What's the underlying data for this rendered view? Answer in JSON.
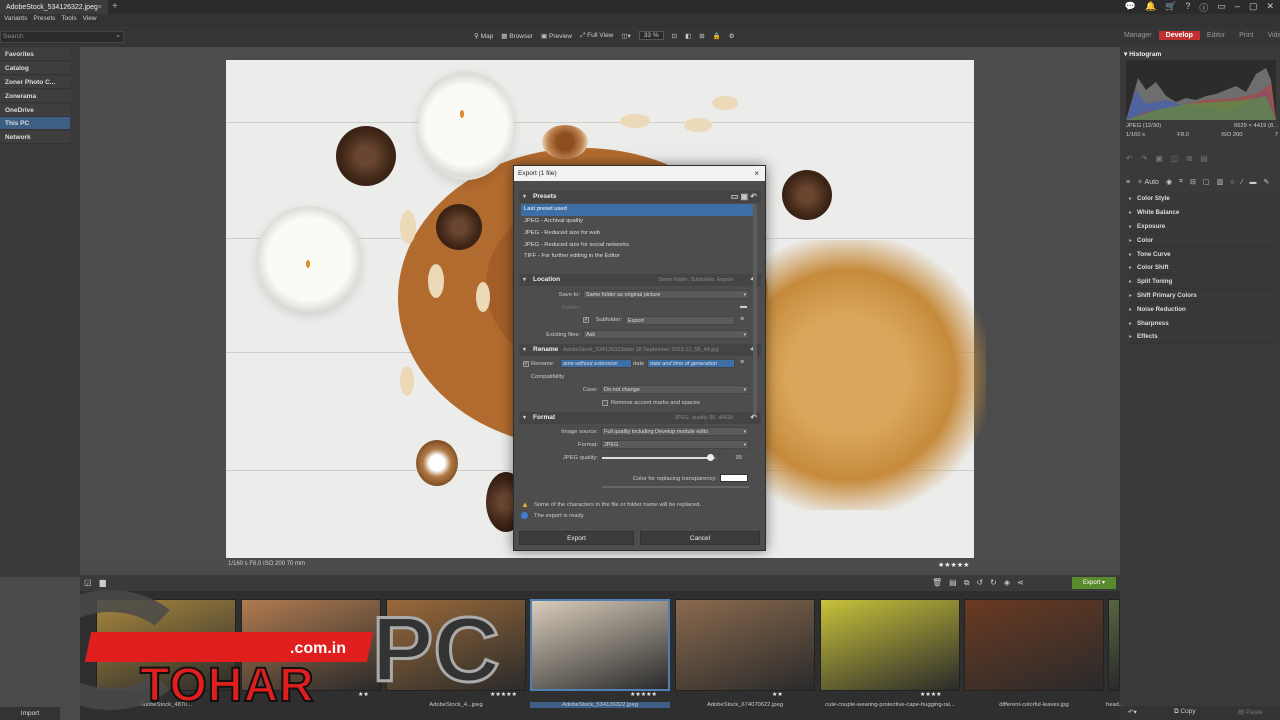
{
  "window": {
    "tab_title": "AdobeStock_534126322.jpeg",
    "tab_close": "×",
    "new_tab": "+"
  },
  "menu": [
    "Variants",
    "Presets",
    "Tools",
    "View"
  ],
  "top_icons": [
    "💬",
    "🔔",
    "🛒",
    "?",
    "ⓘ",
    "▭",
    "–",
    "▢",
    "✕"
  ],
  "search": {
    "placeholder": "Search"
  },
  "view_tools": {
    "map": "Map",
    "browser": "Browser",
    "preview": "Preview",
    "full_view": "Full View",
    "zoom": "33 %"
  },
  "modules": {
    "manager": "Manager",
    "develop": "Develop",
    "editor": "Editor",
    "print": "Print",
    "video": "Video"
  },
  "left_nav": [
    {
      "label": "Favorites"
    },
    {
      "label": "Catalog"
    },
    {
      "label": "Zoner Photo C..."
    },
    {
      "label": "Zonerama"
    },
    {
      "label": "OneDrive"
    },
    {
      "label": "This PC"
    },
    {
      "label": "Network"
    }
  ],
  "photo_status": "1/160 s   F8.0   ISO 200   70 mm",
  "photo_stars": "★★★★★",
  "dialog": {
    "title": "Export (1 file)",
    "close": "×",
    "presets": {
      "heading": "Presets",
      "items": [
        "Last preset used",
        "JPEG - Archival quality",
        "JPEG - Reduced size for web",
        "JPEG - Reduced size for social networks",
        "TIFF - For further editing in the Editor"
      ]
    },
    "location": {
      "heading": "Location",
      "summary": "Same folder, Subfolder: Export",
      "save_to_label": "Save to:",
      "save_to_value": "Same folder as original picture",
      "folder_label": "Folder:",
      "subfolder_label": "Subfolder:",
      "subfolder_value": "Export",
      "existing_label": "Existing files:",
      "existing_value": "Ask"
    },
    "rename": {
      "heading": "Rename",
      "summary": "AdobeStock_534126322date 18 September 2023 12_58_44.jpg",
      "rename_label": "Rename:",
      "token1": "ame without extension",
      "token_sep": "date",
      "token2": "date and time of generation",
      "compat_label": "Compatibility",
      "case_label": "Case:",
      "case_value": "Do not change",
      "remove_accents": "Remove accent marks and spaces"
    },
    "format": {
      "heading": "Format",
      "summary": "JPEG, quality 95, sRGB",
      "source_label": "Image source:",
      "source_value": "Full quality including Develop module edits",
      "format_label": "Format:",
      "format_value": "JPEG",
      "quality_label": "JPEG quality:",
      "quality_value": "95",
      "quality_fraction": 0.95,
      "transparency_label": "Color for replacing transparency:"
    },
    "warning": "Some of the characters in the file or folder name will be replaced.",
    "ready": "The export is ready.",
    "export_btn": "Export",
    "cancel_btn": "Cancel"
  },
  "histogram": {
    "heading": "Histogram",
    "format": "JPEG",
    "index": "(12/30)",
    "dims": "6629 × 4419 (8...",
    "shutter": "1/160 s",
    "aperture": "F8.0",
    "iso": "ISO 200",
    "extra": "7"
  },
  "auto_label": "Auto",
  "adjustments": [
    "Color Style",
    "White Balance",
    "Exposure",
    "Color",
    "Tone Curve",
    "Color Shift",
    "Split Toning",
    "Shift Primary Colors",
    "Noise Reduction",
    "Sharpness",
    "Effects"
  ],
  "filmstrip": {
    "export_btn": "Export",
    "thumbs": [
      {
        "caption": "AdobeStock_4870...",
        "stars": "",
        "color": "#a8873e"
      },
      {
        "caption": "",
        "stars": "★★",
        "color": "#b07b50"
      },
      {
        "caption": "AdobeStock_4...jpeg",
        "stars": "★★★★★",
        "color": "#9a6a3a"
      },
      {
        "caption": "AdobeStock_534126322.jpeg",
        "stars": "★★★★★",
        "color": "#d9cdbb"
      },
      {
        "caption": "AdobeStock_674070622.jpeg",
        "stars": "★★",
        "color": "#8a6a4e"
      },
      {
        "caption": "cute-couple-wearing-protective-cape-hugging-rai...",
        "stars": "★★★★",
        "color": "#c8c23a"
      },
      {
        "caption": "different-colorful-leaves.jpg",
        "stars": "",
        "color": "#6a3a22"
      },
      {
        "caption": "head...",
        "stars": "",
        "color": "#556640"
      }
    ]
  },
  "import_label": "Import",
  "copy_label": "Copy",
  "paste_label": "Paste",
  "watermark": {
    "domain": ".com.in",
    "brand1": "TOHAR",
    "brand2": "PC"
  }
}
